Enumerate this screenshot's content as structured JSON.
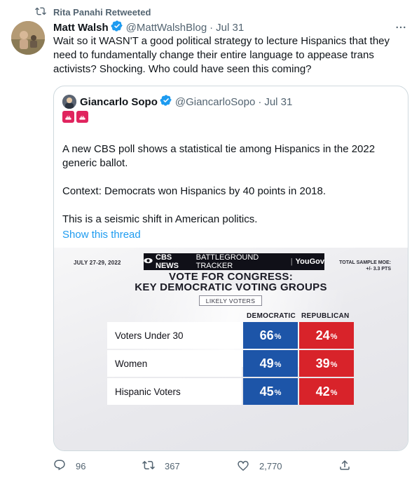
{
  "retweet": {
    "text": "Rita Panahi Retweeted"
  },
  "tweet": {
    "author_name": "Matt Walsh",
    "author_handle": "@MattWalshBlog",
    "separator": "·",
    "date": "Jul 31",
    "text": "Wait so it WASN'T a good political strategy to lecture Hispanics that they need to fundamentally change their entire language to appease trans activists? Shocking. Who could have seen this coming?",
    "more_label": "···"
  },
  "quote": {
    "author_name": "Giancarlo Sopo",
    "author_handle": "@GiancarloSopo",
    "separator": "·",
    "date": "Jul 31",
    "paragraph1": "A new CBS poll shows a statistical tie among Hispanics in the 2022 generic ballot.",
    "paragraph2": "Context: Democrats won Hispanics by 40 points in 2018.",
    "paragraph3": "This is a seismic shift in American politics.",
    "show_thread": "Show this thread"
  },
  "poll": {
    "date": "JULY 27-29, 2022",
    "brand_cbs": "CBS NEWS",
    "brand_tracker": "BATTLEGROUND TRACKER",
    "brand_sep": "|",
    "brand_yougov": "YouGov",
    "moe_line1": "TOTAL SAMPLE MOE:",
    "moe_line2": "+/- 3.3 PTS",
    "title_line1": "VOTE FOR CONGRESS:",
    "title_line2": "KEY DEMOCRATIC VOTING GROUPS",
    "subtitle": "LIKELY VOTERS",
    "col_dem": "DEMOCRATIC",
    "col_rep": "REPUBLICAN",
    "pct_sign": "%",
    "colors": {
      "democratic": "#1d55a8",
      "republican": "#d8232a"
    },
    "rows": [
      {
        "label": "Voters Under 30",
        "dem": "66",
        "rep": "24"
      },
      {
        "label": "Women",
        "dem": "49",
        "rep": "39"
      },
      {
        "label": "Hispanic Voters",
        "dem": "45",
        "rep": "42"
      }
    ]
  },
  "actions": {
    "replies": "96",
    "retweets": "367",
    "likes": "2,770"
  },
  "icons": {
    "retweet": "retweet-icon",
    "verified": "verified-badge-icon",
    "reply": "reply-icon",
    "like": "heart-icon",
    "share": "share-icon",
    "siren": "police-light-icon"
  }
}
